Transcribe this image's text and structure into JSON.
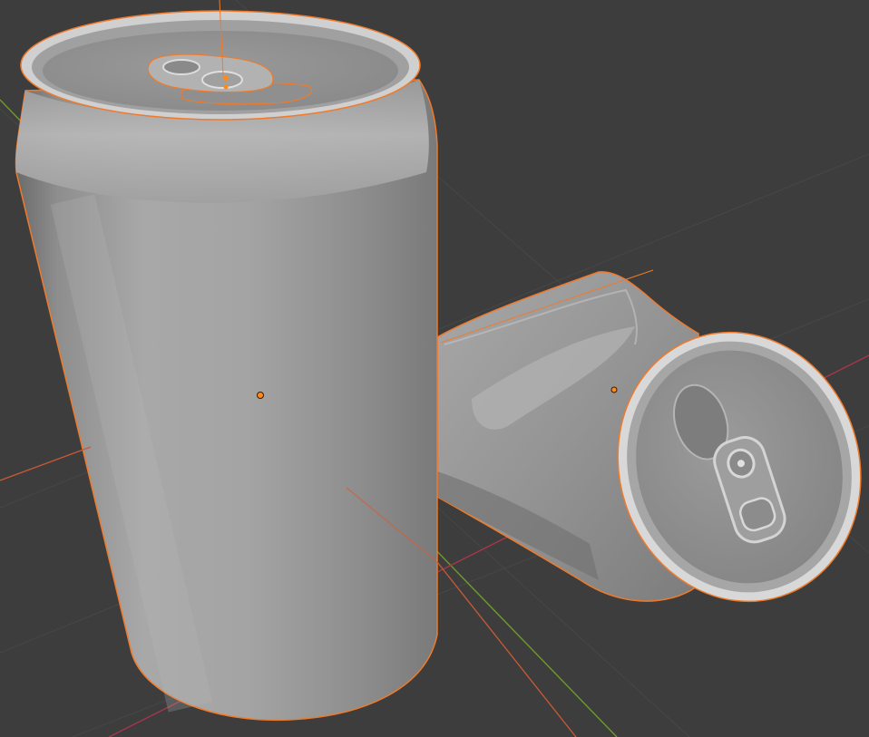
{
  "viewport": {
    "background": "#3d3d3d",
    "grid_color": "#474747"
  },
  "axes": {
    "x_axis_color": "#a6364c",
    "y_axis_color": "#6f9a2b"
  },
  "selection": {
    "outline_color": "#f07a2a",
    "origin_color": "#ff8a1a"
  },
  "objects": [
    {
      "name": "upright-can",
      "state": "selected",
      "orientation": "upright"
    },
    {
      "name": "crushed-can",
      "state": "selected",
      "orientation": "lying"
    }
  ]
}
